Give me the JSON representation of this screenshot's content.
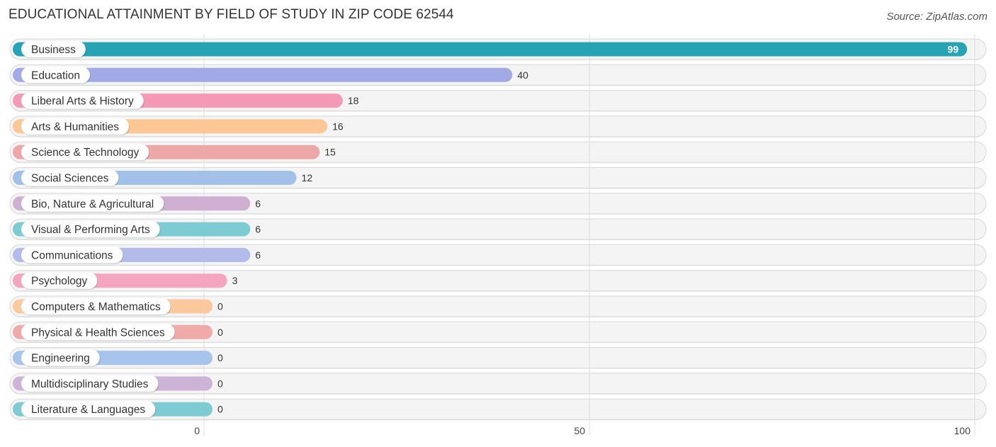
{
  "header": {
    "title": "EDUCATIONAL ATTAINMENT BY FIELD OF STUDY IN ZIP CODE 62544",
    "source": "Source: ZipAtlas.com"
  },
  "chart_data": {
    "type": "bar",
    "orientation": "horizontal",
    "title": "EDUCATIONAL ATTAINMENT BY FIELD OF STUDY IN ZIP CODE 62544",
    "source": "Source: ZipAtlas.com",
    "xlabel": "",
    "ylabel": "",
    "xlim": [
      0,
      100
    ],
    "x_ticks": [
      0,
      50,
      100
    ],
    "x_tick_labels": [
      "0",
      "50",
      "100"
    ],
    "grid": true,
    "legend": "none",
    "categories": [
      "Business",
      "Education",
      "Liberal Arts & History",
      "Arts & Humanities",
      "Science & Technology",
      "Social Sciences",
      "Bio, Nature & Agricultural",
      "Visual & Performing Arts",
      "Communications",
      "Psychology",
      "Computers & Mathematics",
      "Physical & Health Sciences",
      "Engineering",
      "Multidisciplinary Studies",
      "Literature & Languages"
    ],
    "values": [
      99,
      40,
      18,
      16,
      15,
      12,
      6,
      6,
      6,
      3,
      0,
      0,
      0,
      0,
      0
    ],
    "value_labels": [
      "99",
      "40",
      "18",
      "16",
      "15",
      "12",
      "6",
      "6",
      "6",
      "3",
      "0",
      "0",
      "0",
      "0",
      "0"
    ],
    "colors": [
      "#26a3b4",
      "#a2aae6",
      "#f49ab7",
      "#fbc795",
      "#eea7a7",
      "#a1c1e9",
      "#cfb0d2",
      "#7dcbd3",
      "#b3bbea",
      "#f5a5bf",
      "#fbc99d",
      "#f1aaaa",
      "#a6c4ec",
      "#cdb3d6",
      "#7fcbd4"
    ]
  }
}
